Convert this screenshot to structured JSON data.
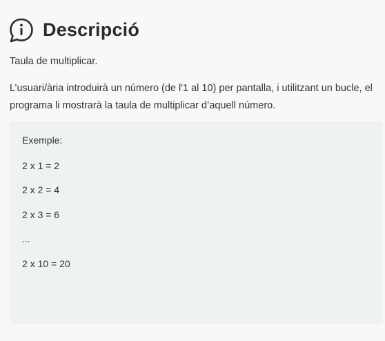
{
  "header": {
    "icon": "info-speech-bubble-icon",
    "title": "Descripció"
  },
  "content": {
    "intro": "Taula de multiplicar.",
    "description": "L’usuari/ària introduirà un número (de l'1 al 10) per pantalla, i utilitzant un bucle, el programa li mostrarà la taula de multiplicar d’aquell número."
  },
  "example": {
    "lines": [
      "Exemple:",
      "2 x 1 = 2",
      "2 x 2 = 4",
      "2 x 3 = 6",
      "...",
      "2 x 10 = 20"
    ]
  },
  "colors": {
    "text": "#2b2b2b",
    "box_background": "#eff2f3",
    "page_background": "#f8f8f8"
  }
}
